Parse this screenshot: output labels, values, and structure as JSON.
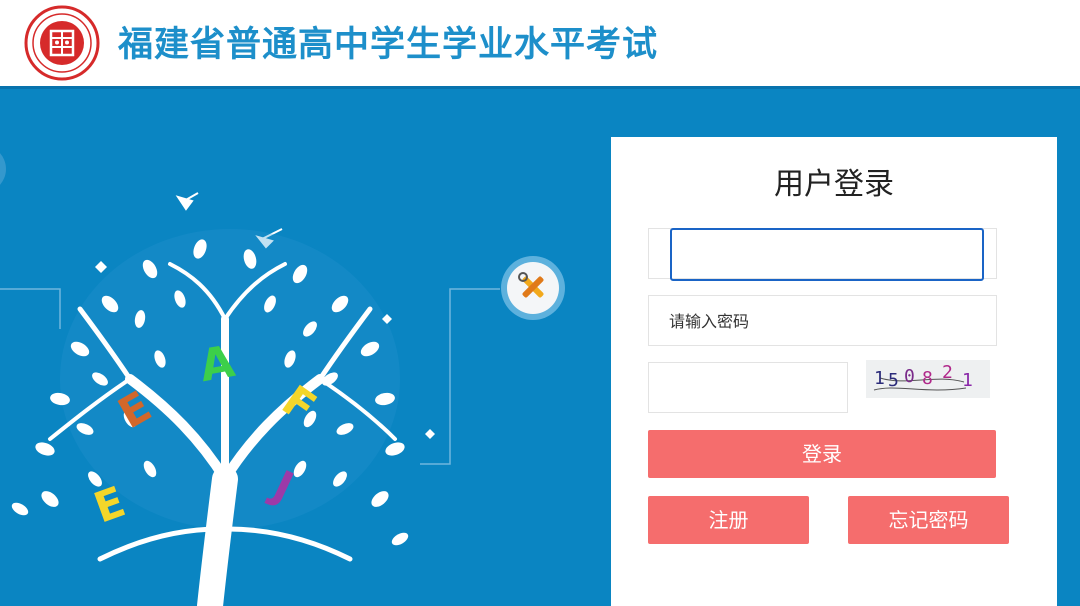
{
  "header": {
    "site_title": "福建省普通高中学生学业水平考试"
  },
  "login": {
    "title": "用户登录",
    "username_value": "",
    "password_placeholder": "请输入密码",
    "captcha_value": "",
    "captcha_text": "150821",
    "login_label": "登录",
    "register_label": "注册",
    "forgot_label": "忘记密码"
  },
  "tree_letters": [
    "A",
    "E",
    "F",
    "E",
    "J"
  ],
  "colors": {
    "banner_bg": "#0a85c2",
    "title_blue": "#1d8fca",
    "button_red": "#f56d6d",
    "input_focus": "#1a64c6"
  }
}
